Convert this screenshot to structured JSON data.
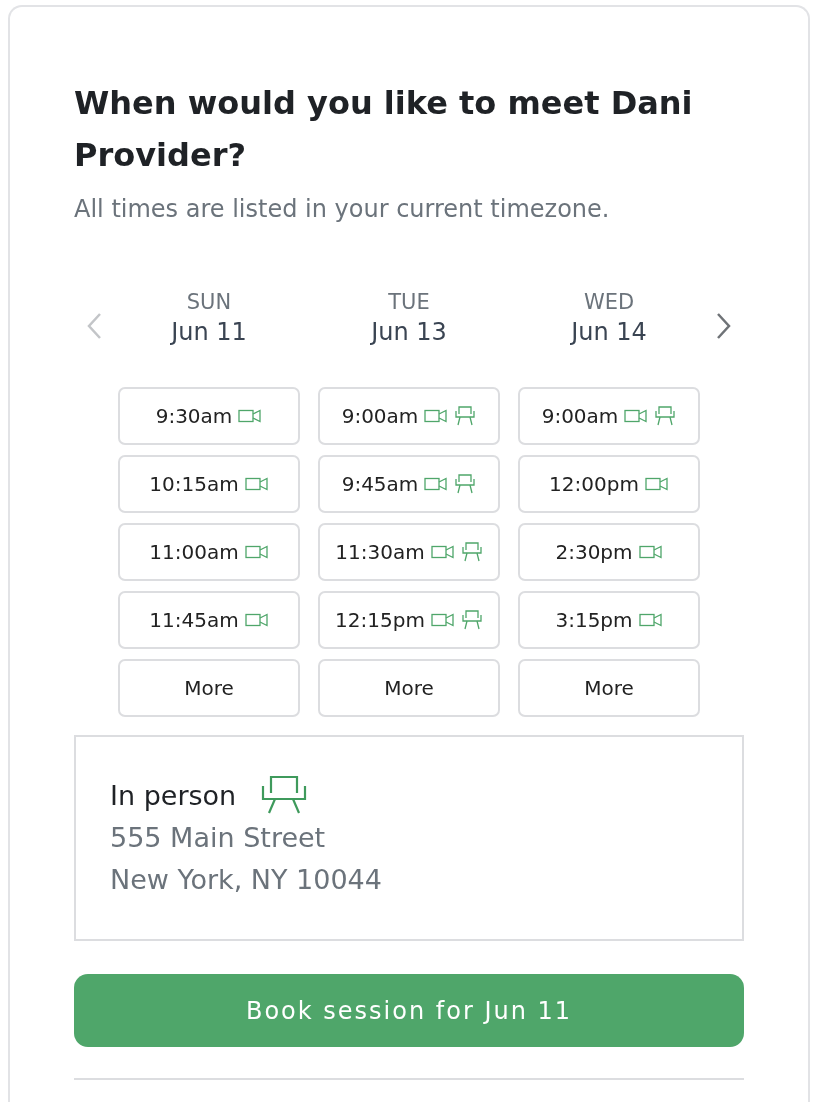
{
  "title": "When would you like to meet Dani Provider?",
  "subtitle": "All times are listed in your current timezone.",
  "nav": {
    "prev_disabled": true,
    "next_disabled": false
  },
  "days": [
    {
      "weekday": "SUN",
      "date": "Jun 11",
      "slots": [
        {
          "kind": "time",
          "label": "9:30am",
          "video": true,
          "in_person": false
        },
        {
          "kind": "time",
          "label": "10:15am",
          "video": true,
          "in_person": false
        },
        {
          "kind": "time",
          "label": "11:00am",
          "video": true,
          "in_person": false
        },
        {
          "kind": "time",
          "label": "11:45am",
          "video": true,
          "in_person": false
        },
        {
          "kind": "more",
          "label": "More"
        }
      ]
    },
    {
      "weekday": "TUE",
      "date": "Jun 13",
      "slots": [
        {
          "kind": "time",
          "label": "9:00am",
          "video": true,
          "in_person": true
        },
        {
          "kind": "time",
          "label": "9:45am",
          "video": true,
          "in_person": true
        },
        {
          "kind": "time",
          "label": "11:30am",
          "video": true,
          "in_person": true
        },
        {
          "kind": "time",
          "label": "12:15pm",
          "video": true,
          "in_person": true
        },
        {
          "kind": "more",
          "label": "More"
        }
      ]
    },
    {
      "weekday": "WED",
      "date": "Jun 14",
      "slots": [
        {
          "kind": "time",
          "label": "9:00am",
          "video": true,
          "in_person": true
        },
        {
          "kind": "time",
          "label": "12:00pm",
          "video": true,
          "in_person": false
        },
        {
          "kind": "time",
          "label": "2:30pm",
          "video": true,
          "in_person": false
        },
        {
          "kind": "time",
          "label": "3:15pm",
          "video": true,
          "in_person": false
        },
        {
          "kind": "more",
          "label": "More"
        }
      ]
    }
  ],
  "location": {
    "label": "In person",
    "address_lines": [
      "555 Main Street",
      "New York, NY 10044"
    ]
  },
  "book_button": "Book session for Jun 11"
}
